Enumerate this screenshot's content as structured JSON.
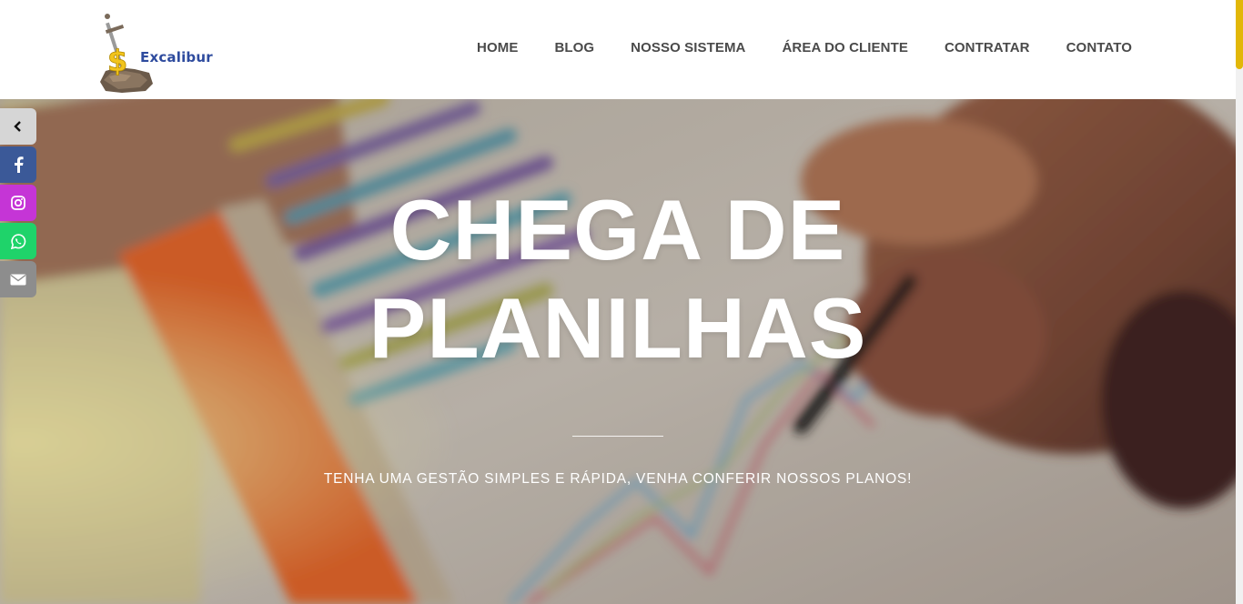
{
  "brand": {
    "name": "Excalibur",
    "colors": {
      "text": "#2e4b9e",
      "gold": "#e2b708"
    }
  },
  "nav": {
    "items": [
      {
        "label": "HOME"
      },
      {
        "label": "BLOG"
      },
      {
        "label": "NOSSO SISTEMA"
      },
      {
        "label": "ÁREA DO CLIENTE"
      },
      {
        "label": "CONTRATAR"
      },
      {
        "label": "CONTATO"
      }
    ]
  },
  "hero": {
    "title_line1": "CHEGA DE",
    "title_line2": "PLANILHAS",
    "subtitle": "TENHA UMA GESTÃO SIMPLES E RÁPIDA, VENHA CONFERIR NOSSOS PLANOS!"
  },
  "social": {
    "items": [
      {
        "icon": "chevron-left-icon",
        "color": "#d6d6d6"
      },
      {
        "icon": "facebook-icon",
        "color": "#3b5998"
      },
      {
        "icon": "instagram-icon",
        "color": "#c535d6"
      },
      {
        "icon": "whatsapp-icon",
        "color": "#1fd36a"
      },
      {
        "icon": "envelope-icon",
        "color": "#8d8d8d"
      }
    ]
  }
}
